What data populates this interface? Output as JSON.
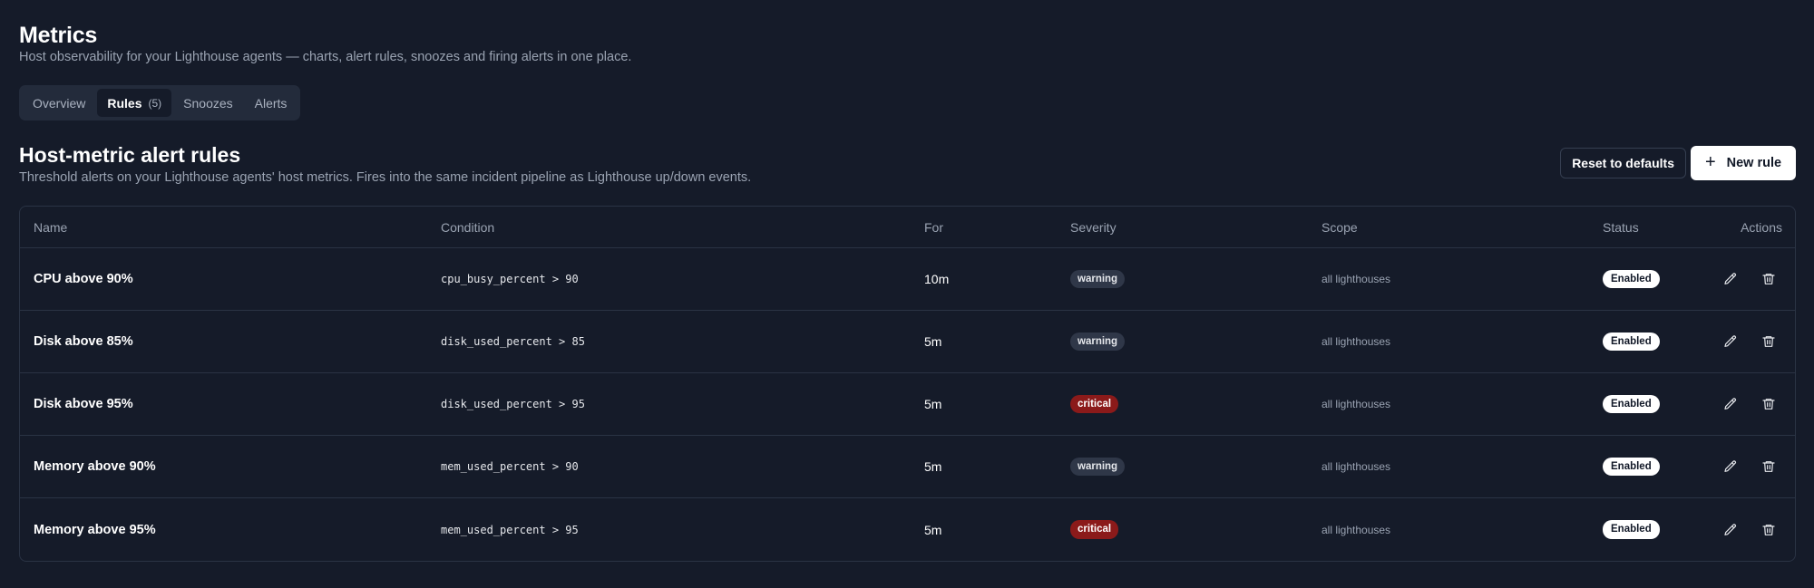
{
  "header": {
    "title": "Metrics",
    "subtitle": "Host observability for your Lighthouse agents — charts, alert rules, snoozes and firing alerts in one place."
  },
  "tabs": [
    {
      "label": "Overview",
      "active": false
    },
    {
      "label": "Rules",
      "count": "(5)",
      "active": true
    },
    {
      "label": "Snoozes",
      "active": false
    },
    {
      "label": "Alerts",
      "active": false
    }
  ],
  "section": {
    "title": "Host-metric alert rules",
    "subtitle": "Threshold alerts on your Lighthouse agents' host metrics. Fires into the same incident pipeline as Lighthouse up/down events.",
    "reset_label": "Reset to defaults",
    "new_label": "New rule",
    "new_icon": "plus-icon"
  },
  "table": {
    "columns": {
      "name": "Name",
      "condition": "Condition",
      "for": "For",
      "severity": "Severity",
      "scope": "Scope",
      "status": "Status",
      "actions": "Actions"
    },
    "rows": [
      {
        "name": "CPU above 90%",
        "condition": "cpu_busy_percent > 90",
        "for": "10m",
        "severity": "warning",
        "scope": "all lighthouses",
        "status": "Enabled"
      },
      {
        "name": "Disk above 85%",
        "condition": "disk_used_percent > 85",
        "for": "5m",
        "severity": "warning",
        "scope": "all lighthouses",
        "status": "Enabled"
      },
      {
        "name": "Disk above 95%",
        "condition": "disk_used_percent > 95",
        "for": "5m",
        "severity": "critical",
        "scope": "all lighthouses",
        "status": "Enabled"
      },
      {
        "name": "Memory above 90%",
        "condition": "mem_used_percent > 90",
        "for": "5m",
        "severity": "warning",
        "scope": "all lighthouses",
        "status": "Enabled"
      },
      {
        "name": "Memory above 95%",
        "condition": "mem_used_percent > 95",
        "for": "5m",
        "severity": "critical",
        "scope": "all lighthouses",
        "status": "Enabled"
      }
    ]
  },
  "colors": {
    "background": "#151b29",
    "critical": "#8b1a1a",
    "warning": "#2f3748"
  }
}
